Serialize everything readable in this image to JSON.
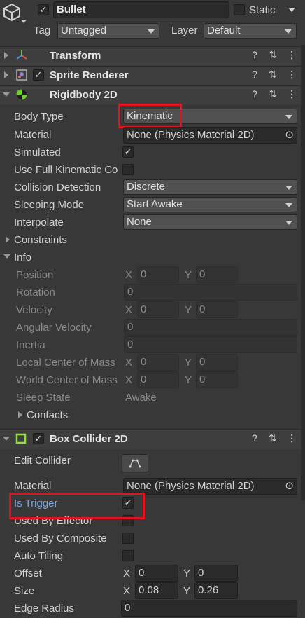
{
  "object": {
    "name": "Bullet",
    "static_label": "Static",
    "tag_label": "Tag",
    "tag_value": "Untagged",
    "layer_label": "Layer",
    "layer_value": "Default"
  },
  "components": {
    "transform": "Transform",
    "sprite_renderer": "Sprite Renderer",
    "rigidbody": "Rigidbody 2D",
    "box_collider": "Box Collider 2D"
  },
  "rigidbody": {
    "body_type_label": "Body Type",
    "body_type_value": "Kinematic",
    "material_label": "Material",
    "material_value": "None (Physics Material 2D)",
    "simulated_label": "Simulated",
    "full_kinematic_label": "Use Full Kinematic Co",
    "collision_label": "Collision Detection",
    "collision_value": "Discrete",
    "sleeping_label": "Sleeping Mode",
    "sleeping_value": "Start Awake",
    "interpolate_label": "Interpolate",
    "interpolate_value": "None",
    "constraints_label": "Constraints",
    "info_label": "Info",
    "position_label": "Position",
    "rotation_label": "Rotation",
    "velocity_label": "Velocity",
    "angular_velocity_label": "Angular Velocity",
    "inertia_label": "Inertia",
    "local_com_label": "Local Center of Mass",
    "world_com_label": "World Center of Mass",
    "sleep_state_label": "Sleep State",
    "sleep_state_value": "Awake",
    "contacts_label": "Contacts",
    "x": "X",
    "y": "Y",
    "zero": "0"
  },
  "box_collider": {
    "edit_collider_label": "Edit Collider",
    "material_label": "Material",
    "material_value": "None (Physics Material 2D)",
    "is_trigger_label": "Is Trigger",
    "used_by_effector_label": "Used By Effector",
    "used_by_composite_label": "Used By Composite",
    "auto_tiling_label": "Auto Tiling",
    "offset_label": "Offset",
    "offset_x": "0",
    "offset_y": "0",
    "size_label": "Size",
    "size_x": "0.08",
    "size_y": "0.26",
    "edge_radius_label": "Edge Radius",
    "edge_radius_value": "0"
  },
  "glyphs": {
    "check": "✓",
    "help": "?",
    "menu": "⋮",
    "preset": "⇅",
    "target": "⊙"
  },
  "colors": {
    "highlight": "#e0141e",
    "trigger_label": "#7ea6e0"
  }
}
